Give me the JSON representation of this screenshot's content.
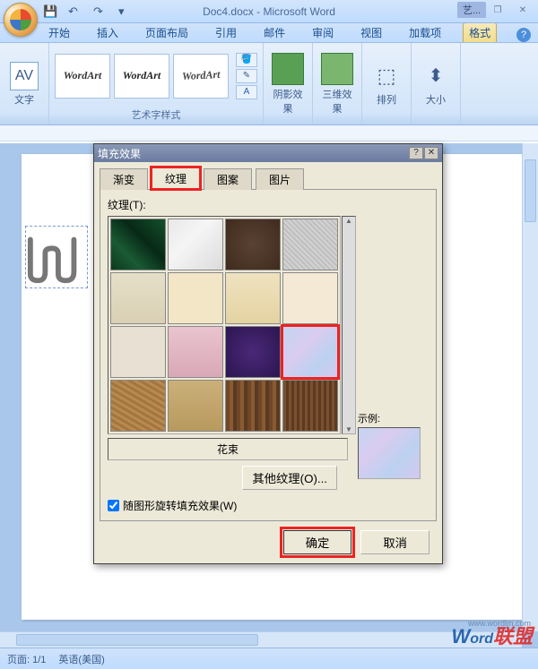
{
  "title": "Doc4.docx - Microsoft Word",
  "context_tab": "艺...",
  "ribbon_tabs": [
    "开始",
    "插入",
    "页面布局",
    "引用",
    "邮件",
    "审阅",
    "视图",
    "加载项",
    "格式"
  ],
  "ribbon": {
    "text_group": {
      "label": "文字",
      "button": "AV"
    },
    "style_group": {
      "label": "艺术字样式",
      "samples": [
        "WordArt",
        "WordArt",
        "WordArt"
      ]
    },
    "shadow": "阴影效果",
    "threeD": "三维效果",
    "arrange": "排列",
    "size": "大小"
  },
  "dialog": {
    "title": "填充效果",
    "tabs": [
      "渐变",
      "纹理",
      "图案",
      "图片"
    ],
    "active_tab": 1,
    "texture_label": "纹理(T):",
    "texname": "花束",
    "other_btn": "其他纹理(O)...",
    "sample_label": "示例:",
    "rotate_check": "随图形旋转填充效果(W)",
    "ok": "确定",
    "cancel": "取消"
  },
  "statusbar": {
    "page": "页面: 1/1",
    "lang": "英语(美国)"
  },
  "watermark": {
    "main_w": "W",
    "main_rest": "ord",
    "red": "联盟",
    "url": "www.wordlm.com"
  }
}
